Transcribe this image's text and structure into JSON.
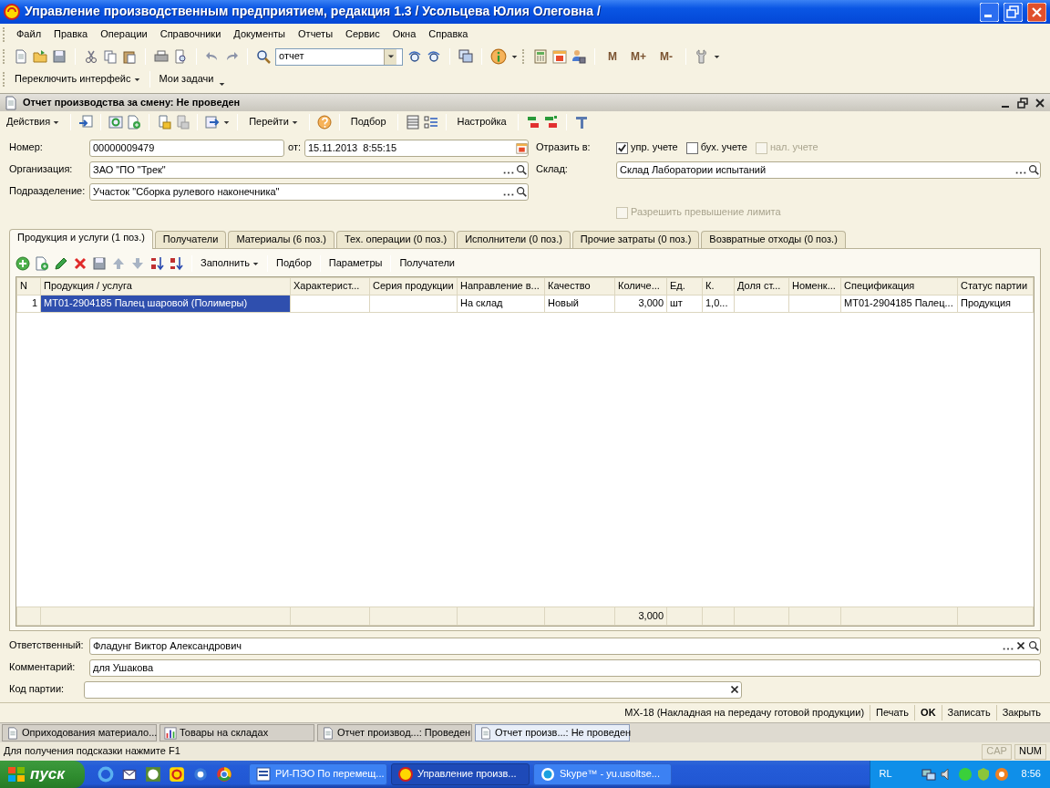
{
  "window": {
    "title": "Управление производственным предприятием, редакция 1.3 / Усольцева Юлия Олеговна /"
  },
  "menu": [
    {
      "label": "Файл"
    },
    {
      "label": "Правка"
    },
    {
      "label": "Операции"
    },
    {
      "label": "Справочники"
    },
    {
      "label": "Документы"
    },
    {
      "label": "Отчеты"
    },
    {
      "label": "Сервис"
    },
    {
      "label": "Окна"
    },
    {
      "label": "Справка"
    }
  ],
  "toolbar": {
    "search_value": "отчет",
    "memory_buttons": [
      {
        "label": "M"
      },
      {
        "label": "M+"
      },
      {
        "label": "M-"
      }
    ]
  },
  "panel_bar": [
    {
      "label": "Переключить интерфейс",
      "dropdown": true
    },
    {
      "label": "Мои задачи",
      "dropdown": false
    }
  ],
  "document": {
    "title": "Отчет производства за смену: Не проведен",
    "toolbar": [
      {
        "label": "Действия",
        "dropdown": true
      },
      {
        "label": "Перейти",
        "dropdown": true
      },
      {
        "label": "Подбор",
        "dropdown": false
      },
      {
        "label": "Настройка",
        "dropdown": false
      }
    ]
  },
  "header": {
    "number": {
      "label": "Номер:",
      "value": "00000009479"
    },
    "date": {
      "label": "от:",
      "value": "15.11.2013  8:55:15"
    },
    "organization": {
      "label": "Организация:",
      "value": "ЗАО \"ПО \"Трек\""
    },
    "department": {
      "label": "Подразделение:",
      "value": "Участок \"Сборка рулевого наконечника\""
    },
    "reflect": {
      "label": "Отразить в:",
      "options": [
        {
          "label": "упр. учете",
          "checked": true,
          "disabled": false
        },
        {
          "label": "бух. учете",
          "checked": false,
          "disabled": false
        },
        {
          "label": "нал. учете",
          "checked": false,
          "disabled": true
        }
      ]
    },
    "warehouse": {
      "label": "Склад:",
      "value": "Склад Лаборатории испытаний"
    },
    "allow_limit": {
      "label": "Разрешить превышение лимита",
      "checked": false,
      "disabled": true
    }
  },
  "tabs": [
    {
      "label": "Продукция и услуги (1 поз.)",
      "selected": true
    },
    {
      "label": "Получатели",
      "selected": false
    },
    {
      "label": "Материалы (6 поз.)",
      "selected": false
    },
    {
      "label": "Тех. операции (0 поз.)",
      "selected": false
    },
    {
      "label": "Исполнители (0 поз.)",
      "selected": false
    },
    {
      "label": "Прочие затраты (0 поз.)",
      "selected": false
    },
    {
      "label": "Возвратные отходы (0 поз.)",
      "selected": false
    }
  ],
  "table_toolbar": [
    {
      "label": "Заполнить",
      "dropdown": true
    },
    {
      "label": "Подбор",
      "dropdown": false
    },
    {
      "label": "Параметры",
      "dropdown": false
    },
    {
      "label": "Получатели",
      "dropdown": false
    }
  ],
  "table": {
    "columns": [
      {
        "label": "N"
      },
      {
        "label": "Продукция / услуга"
      },
      {
        "label": "Характерист..."
      },
      {
        "label": "Серия продукции"
      },
      {
        "label": "Направление в..."
      },
      {
        "label": "Качество"
      },
      {
        "label": "Количе...",
        "total": "3,000"
      },
      {
        "label": "Ед."
      },
      {
        "label": "К."
      },
      {
        "label": "Доля ст..."
      },
      {
        "label": "Номенк..."
      },
      {
        "label": "Спецификация"
      },
      {
        "label": "Статус партии"
      }
    ],
    "rows": [
      {
        "selected": true,
        "cells": [
          "1",
          "МТ01-2904185 Палец шаровой (Полимеры)",
          null,
          null,
          "На склад",
          "Новый",
          "3,000",
          "шт",
          "1,0...",
          null,
          null,
          "МТ01-2904185 Палец...",
          "Продукция"
        ]
      }
    ]
  },
  "footer_fields": {
    "responsible": {
      "label": "Ответственный:",
      "value": "Фладунг Виктор Александрович"
    },
    "comment": {
      "label": "Комментарий:",
      "value": "для Ушакова"
    },
    "batch_code": {
      "label": "Код партии:"
    }
  },
  "actions": [
    {
      "label": "МХ-18 (Накладная на передачу готовой продукции)",
      "default": false
    },
    {
      "label": "Печать",
      "default": false
    },
    {
      "label": "OK",
      "default": true
    },
    {
      "label": "Записать",
      "default": false
    },
    {
      "label": "Закрыть",
      "default": false
    }
  ],
  "window_tabs": [
    {
      "label": "Оприходования материало...",
      "kind": "document",
      "selected": false
    },
    {
      "label": "Товары на складах",
      "kind": "report",
      "selected": false
    },
    {
      "label": "Отчет производ...: Проведен",
      "kind": "document",
      "selected": false
    },
    {
      "label": "Отчет произв...: Не проведен",
      "kind": "document",
      "selected": true
    }
  ],
  "status_bar": {
    "hint": "Для получения подсказки нажмите F1",
    "indicators": [
      {
        "label": "CAP",
        "on": false
      },
      {
        "label": "NUM",
        "on": true
      }
    ]
  },
  "taskbar": {
    "start": "пуск",
    "tasks": [
      {
        "label": "РИ-ПЭО По перемещ...",
        "kind": "word",
        "selected": false
      },
      {
        "label": "Управление произв...",
        "kind": "onec",
        "selected": true
      },
      {
        "label": "Skype™ - yu.usoltse...",
        "kind": "skype",
        "selected": false
      }
    ],
    "language": "RL",
    "clock": "8:56"
  }
}
